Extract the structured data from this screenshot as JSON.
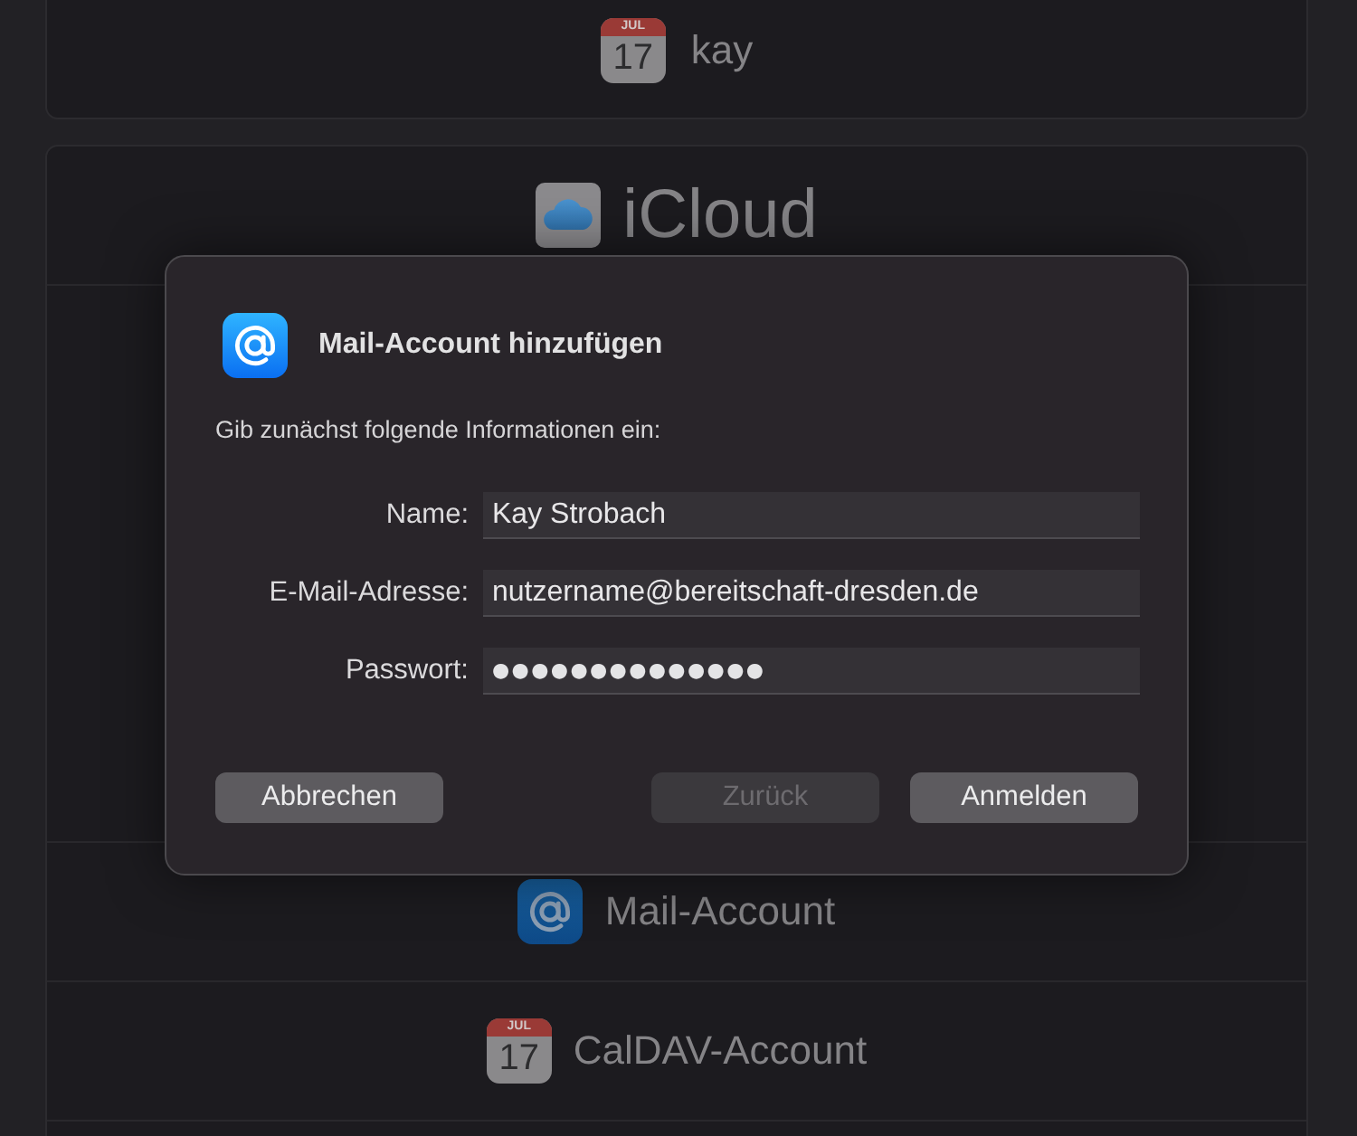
{
  "background": {
    "account_header": {
      "label": "kay",
      "icon": {
        "month": "JUL",
        "day": "17"
      }
    },
    "providers": [
      {
        "kind": "icloud",
        "label": "iCloud"
      },
      {
        "kind": "mail",
        "label": "Mail-Account"
      },
      {
        "kind": "calendar",
        "label": "CalDAV-Account",
        "icon": {
          "month": "JUL",
          "day": "17"
        }
      }
    ]
  },
  "dialog": {
    "title": "Mail-Account hinzufügen",
    "subtitle": "Gib zunächst folgende Informationen ein:",
    "fields": [
      {
        "kind": "text",
        "label": "Name:",
        "value": "Kay Strobach"
      },
      {
        "kind": "text",
        "label": "E-Mail-Adresse:",
        "value": "nutzername@bereitschaft-dresden.de"
      },
      {
        "kind": "password",
        "label": "Passwort:",
        "value": "●●●●●●●●●●●●●●"
      }
    ],
    "buttons_left": [
      {
        "label": "Abbrechen",
        "disabled": false
      }
    ],
    "buttons_right": [
      {
        "label": "Zurück",
        "disabled": true
      },
      {
        "label": "Anmelden",
        "disabled": false
      }
    ]
  }
}
